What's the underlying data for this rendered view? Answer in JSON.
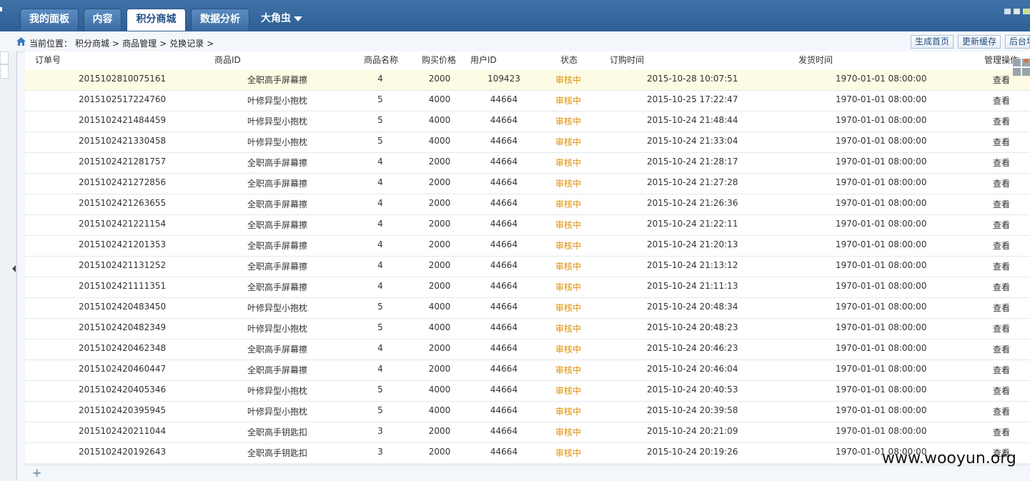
{
  "nav": {
    "tabs": [
      "我的面板",
      "内容",
      "积分商城",
      "数据分析",
      "大角虫"
    ],
    "active_tab": "积分商城"
  },
  "breadcrumb": {
    "prefix": "当前位置：",
    "items": [
      "积分商城",
      "商品管理",
      "兑换记录"
    ],
    "separator": ">"
  },
  "toolbar": {
    "buttons": [
      "生成首页",
      "更新缓存",
      "后台地图"
    ]
  },
  "table": {
    "headers": [
      "订单号",
      "商品ID",
      "商品名称",
      "购买价格",
      "用户ID",
      "状态",
      "订购时间",
      "发货时间",
      "管理操作"
    ],
    "rows": [
      {
        "order": "2015102810075161",
        "product": "全职高手屏幕擦",
        "name": "4",
        "price": "2000",
        "uid": "109423",
        "status": "审核中",
        "order_time": "2015-10-28 10:07:51",
        "ship_time": "1970-01-01 08:00:00",
        "action": "查看"
      },
      {
        "order": "2015102517224760",
        "product": "叶修异型小抱枕",
        "name": "5",
        "price": "4000",
        "uid": "44664",
        "status": "审核中",
        "order_time": "2015-10-25 17:22:47",
        "ship_time": "1970-01-01 08:00:00",
        "action": "查看"
      },
      {
        "order": "2015102421484459",
        "product": "叶修异型小抱枕",
        "name": "5",
        "price": "4000",
        "uid": "44664",
        "status": "审核中",
        "order_time": "2015-10-24 21:48:44",
        "ship_time": "1970-01-01 08:00:00",
        "action": "查看"
      },
      {
        "order": "2015102421330458",
        "product": "叶修异型小抱枕",
        "name": "5",
        "price": "4000",
        "uid": "44664",
        "status": "审核中",
        "order_time": "2015-10-24 21:33:04",
        "ship_time": "1970-01-01 08:00:00",
        "action": "查看"
      },
      {
        "order": "2015102421281757",
        "product": "全职高手屏幕擦",
        "name": "4",
        "price": "2000",
        "uid": "44664",
        "status": "审核中",
        "order_time": "2015-10-24 21:28:17",
        "ship_time": "1970-01-01 08:00:00",
        "action": "查看"
      },
      {
        "order": "2015102421272856",
        "product": "全职高手屏幕擦",
        "name": "4",
        "price": "2000",
        "uid": "44664",
        "status": "审核中",
        "order_time": "2015-10-24 21:27:28",
        "ship_time": "1970-01-01 08:00:00",
        "action": "查看"
      },
      {
        "order": "2015102421263655",
        "product": "全职高手屏幕擦",
        "name": "4",
        "price": "2000",
        "uid": "44664",
        "status": "审核中",
        "order_time": "2015-10-24 21:26:36",
        "ship_time": "1970-01-01 08:00:00",
        "action": "查看"
      },
      {
        "order": "2015102421221154",
        "product": "全职高手屏幕擦",
        "name": "4",
        "price": "2000",
        "uid": "44664",
        "status": "审核中",
        "order_time": "2015-10-24 21:22:11",
        "ship_time": "1970-01-01 08:00:00",
        "action": "查看"
      },
      {
        "order": "2015102421201353",
        "product": "全职高手屏幕擦",
        "name": "4",
        "price": "2000",
        "uid": "44664",
        "status": "审核中",
        "order_time": "2015-10-24 21:20:13",
        "ship_time": "1970-01-01 08:00:00",
        "action": "查看"
      },
      {
        "order": "2015102421131252",
        "product": "全职高手屏幕擦",
        "name": "4",
        "price": "2000",
        "uid": "44664",
        "status": "审核中",
        "order_time": "2015-10-24 21:13:12",
        "ship_time": "1970-01-01 08:00:00",
        "action": "查看"
      },
      {
        "order": "2015102421111351",
        "product": "全职高手屏幕擦",
        "name": "4",
        "price": "2000",
        "uid": "44664",
        "status": "审核中",
        "order_time": "2015-10-24 21:11:13",
        "ship_time": "1970-01-01 08:00:00",
        "action": "查看"
      },
      {
        "order": "2015102420483450",
        "product": "叶修异型小抱枕",
        "name": "5",
        "price": "4000",
        "uid": "44664",
        "status": "审核中",
        "order_time": "2015-10-24 20:48:34",
        "ship_time": "1970-01-01 08:00:00",
        "action": "查看"
      },
      {
        "order": "2015102420482349",
        "product": "叶修异型小抱枕",
        "name": "5",
        "price": "4000",
        "uid": "44664",
        "status": "审核中",
        "order_time": "2015-10-24 20:48:23",
        "ship_time": "1970-01-01 08:00:00",
        "action": "查看"
      },
      {
        "order": "2015102420462348",
        "product": "全职高手屏幕擦",
        "name": "4",
        "price": "2000",
        "uid": "44664",
        "status": "审核中",
        "order_time": "2015-10-24 20:46:23",
        "ship_time": "1970-01-01 08:00:00",
        "action": "查看"
      },
      {
        "order": "2015102420460447",
        "product": "全职高手屏幕擦",
        "name": "4",
        "price": "2000",
        "uid": "44664",
        "status": "审核中",
        "order_time": "2015-10-24 20:46:04",
        "ship_time": "1970-01-01 08:00:00",
        "action": "查看"
      },
      {
        "order": "2015102420405346",
        "product": "叶修异型小抱枕",
        "name": "5",
        "price": "4000",
        "uid": "44664",
        "status": "审核中",
        "order_time": "2015-10-24 20:40:53",
        "ship_time": "1970-01-01 08:00:00",
        "action": "查看"
      },
      {
        "order": "2015102420395945",
        "product": "叶修异型小抱枕",
        "name": "5",
        "price": "4000",
        "uid": "44664",
        "status": "审核中",
        "order_time": "2015-10-24 20:39:58",
        "ship_time": "1970-01-01 08:00:00",
        "action": "查看"
      },
      {
        "order": "2015102420211044",
        "product": "全职高手钥匙扣",
        "name": "3",
        "price": "2000",
        "uid": "44664",
        "status": "审核中",
        "order_time": "2015-10-24 20:21:09",
        "ship_time": "1970-01-01 08:00:00",
        "action": "查看"
      },
      {
        "order": "2015102420192643",
        "product": "全职高手钥匙扣",
        "name": "3",
        "price": "2000",
        "uid": "44664",
        "status": "审核中",
        "order_time": "2015-10-24 20:19:26",
        "ship_time": "1970-01-01 08:00:00",
        "action": "查看"
      }
    ]
  },
  "colors": {
    "topbar": "#3467a0",
    "status_pending": "#e08e00",
    "highlight_row": "#fdfbe3"
  },
  "icons": [
    "home-icon",
    "grid-icon",
    "plus-icon",
    "collapse-arrow-icon",
    "dropdown-arrow-icon"
  ],
  "watermark": "www.wooyun.org"
}
